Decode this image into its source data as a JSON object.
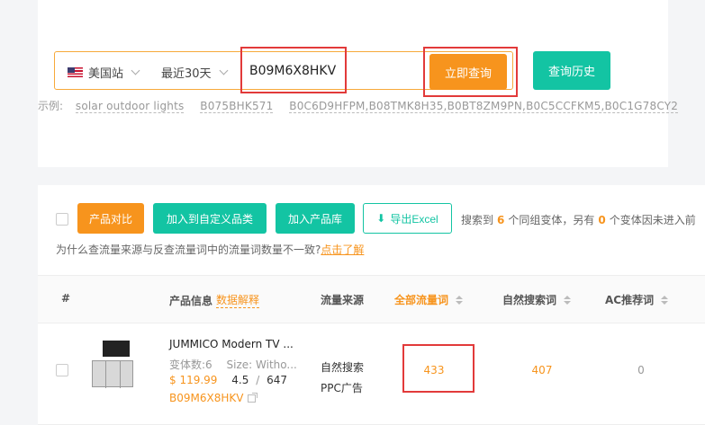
{
  "search": {
    "site": "美国站",
    "range": "最近30天",
    "asin": "B09M6X8HKV",
    "query_label": "立即查询",
    "history_label": "查询历史",
    "examples_prefix": "示例:",
    "examples": [
      "solar outdoor lights",
      "B075BHK571",
      "B0C6D9HFPM,B08TMK8H35,B0BT8ZM9PN,B0C5CCFKM5,B0C1G78CY2"
    ]
  },
  "actions": {
    "compare": "产品对比",
    "add_category": "加入到自定义品类",
    "add_library": "加入产品库",
    "export": "导出Excel",
    "summary_prefix": "搜索到",
    "summary_count": "6",
    "summary_mid": "个同组变体，另有",
    "summary_other": "0",
    "summary_suffix": "个变体因未进入前",
    "why_text": "为什么查流量来源与反查流量词中的流量词数量不一致?",
    "why_link": "点击了解"
  },
  "table": {
    "headers": {
      "index": "#",
      "product": "产品信息",
      "product_help": "数据解释",
      "source": "流量来源",
      "all_words": "全部流量词",
      "organic": "自然搜索词",
      "ac": "AC推荐词"
    },
    "rows": [
      {
        "title": "JUMMICO Modern TV ...",
        "variants": "变体数:6",
        "size": "Size: Witho...",
        "price": "$ 119.99",
        "rating": "4.5",
        "reviews": "647",
        "asin": "B09M6X8HKV",
        "source_1": "自然搜索",
        "source_2": "PPC广告",
        "all_words": "433",
        "organic": "407",
        "ac": "0"
      }
    ]
  },
  "colors": {
    "accent": "#f7941d",
    "green": "#13c4a3",
    "highlight": "#e23a3a"
  }
}
